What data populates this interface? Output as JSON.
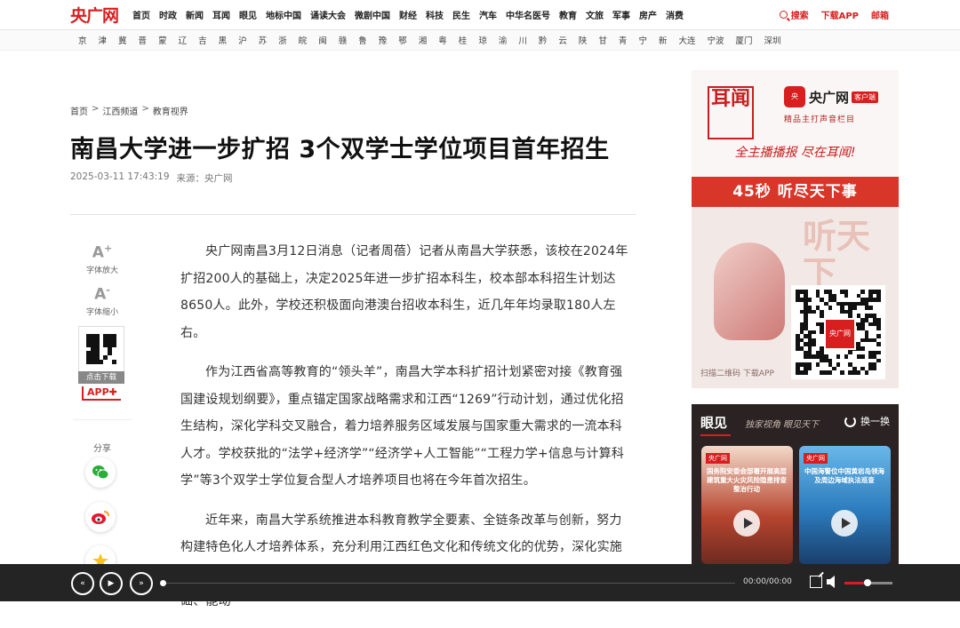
{
  "nav": {
    "logo": "央广网",
    "items": [
      "首页",
      "时政",
      "新闻",
      "耳闻",
      "眼见",
      "地标中国",
      "诵读大会",
      "微剧中国",
      "财经",
      "科技",
      "民生",
      "汽车",
      "中华名医号",
      "教育",
      "文旅",
      "军事",
      "房产",
      "消费"
    ],
    "search": "搜索",
    "download": "下载APP",
    "mail": "邮箱"
  },
  "provinces": [
    "京",
    "津",
    "冀",
    "晋",
    "蒙",
    "辽",
    "吉",
    "黑",
    "沪",
    "苏",
    "浙",
    "皖",
    "闽",
    "赣",
    "鲁",
    "豫",
    "鄂",
    "湘",
    "粤",
    "桂",
    "琼",
    "渝",
    "川",
    "黔",
    "云",
    "陕",
    "甘",
    "青",
    "宁",
    "新",
    "大连",
    "宁波",
    "厦门",
    "深圳"
  ],
  "breadcrumb": [
    "首页",
    "江西频道",
    "教育视界"
  ],
  "article": {
    "title": "南昌大学进一步扩招 3个双学士学位项目首年招生",
    "date": "2025-03-11 17:43:19",
    "source": "来源：央广网",
    "paragraphs": [
      "央广网南昌3月12日消息（记者周蓓）记者从南昌大学获悉，该校在2024年扩招200人的基础上，决定2025年进一步扩招本科生，校本部本科招生计划达8650人。此外，学校还积极面向港澳台招收本科生，近几年年均录取180人左右。",
      "作为江西省高等教育的“领头羊”，南昌大学本科扩招计划紧密对接《教育强国建设规划纲要》，重点锚定国家战略需求和江西“1269”行动计划，通过优化招生结构，深化学科交叉融合，着力培养服务区域发展与国家重大需求的一流本科人才。学校获批的“法学+经济学”“经济学+人工智能”“工程力学+信息与计算科学”等3个双学士学位复合型人才培养项目也将在今年首次招生。",
      "近年来，南昌大学系统推进本科教育教学全要素、全链条改革与创新，努力构建特色化人才培养体系，充分利用江西红色文化和传统文化的优势，深化实施素质教育，促进学生德智体美劳全面发展，为社会输送“有情怀、肯吃苦、厚基础、能动"
    ]
  },
  "tools": {
    "font_up_glyph": "A",
    "font_up": "字体放大",
    "font_down_glyph": "A",
    "font_down": "字体缩小",
    "qr_caption": "点击下载",
    "app": "APP",
    "share": "分享"
  },
  "ad1": {
    "erwen": "耳闻",
    "brand": "央广网",
    "brand_tag": "客户端",
    "brand_sub": "精品主打声音栏目",
    "slogan": "全主播播报 尽在耳闻!",
    "band": "45秒 听尽天下事",
    "ting": "听天下",
    "qr_center": "央广网",
    "caption": "扫描二维码 下载APP"
  },
  "ad2": {
    "title": "眼见",
    "subtitle": "独家视角 眼见天下",
    "refresh": "换一换",
    "card1_tag": "央广网",
    "card1_text": "国务院安委会部署开展高层建筑重大火灾风险隐患排查整治行动",
    "card2_tag": "央广网",
    "card2_text": "中国海警位中国黄岩岛领海及周边海域执法巡查"
  },
  "player": {
    "rewind": "«",
    "play": "▶",
    "forward": "»",
    "time": "00:00/00:00"
  }
}
